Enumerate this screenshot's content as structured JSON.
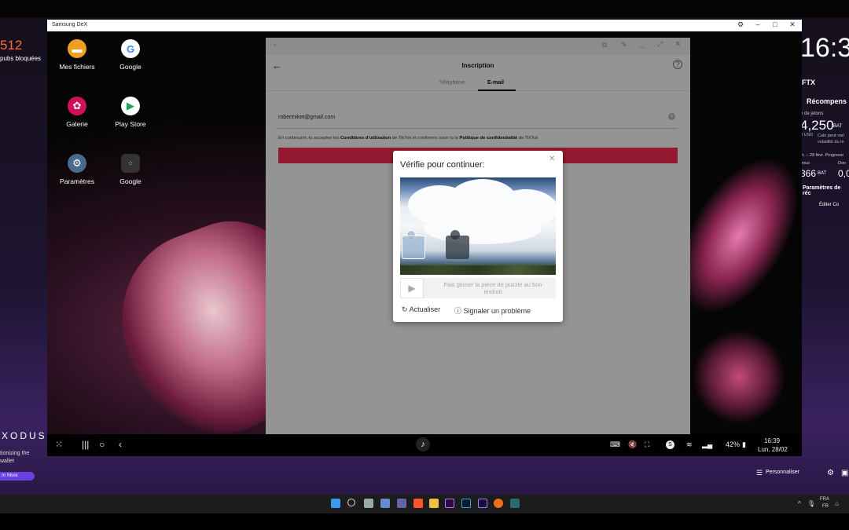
{
  "left_panel": {
    "count": "512",
    "blocked_label": "pubs bloquées",
    "exodus_brand": "XODUS",
    "exodus_line1": "tionizing the",
    "exodus_line2": "wallet",
    "learn_more": "rn More"
  },
  "right_panel": {
    "time": "16:3",
    "ftx": "FTX",
    "recompenses": "Récompens",
    "jetons_label": "e de jetons",
    "bat_amount": "4,250",
    "bat_unit": "BAT",
    "usd": "0 USD",
    "calc_note": "Calo peut vari volatilité du m",
    "progress_label": "vr. – 28 févr. Progressi",
    "bonus_label": "onus",
    "don_label": "Don",
    "bonus_value": "366",
    "bonus_unit": "BAT",
    "don_value": "0,0",
    "params": "Paramètres de réc",
    "editer": "Éditer Co",
    "personnaliser": "Personnaliser"
  },
  "dex": {
    "window_title": "Samsung DeX",
    "apps": [
      {
        "label": "Mes fichiers",
        "icon": "folder-icon",
        "color": "#f0a020"
      },
      {
        "label": "Google",
        "icon": "google-icon",
        "color": "#ffffff"
      },
      {
        "label": "Galerie",
        "icon": "gallery-icon",
        "color": "#d0105a"
      },
      {
        "label": "Play Store",
        "icon": "play-store-icon",
        "color": "#ffffff"
      },
      {
        "label": "Paramètres",
        "icon": "settings-icon",
        "color": "#4a6a8a"
      },
      {
        "label": "Google",
        "icon": "google-folder-icon",
        "color": "#333333"
      }
    ],
    "taskbar": {
      "battery": "42%",
      "time": "16:39",
      "date": "Lun. 28/02"
    }
  },
  "tiktok": {
    "title": "Inscription",
    "tabs": [
      "Téléphone",
      "E-mail"
    ],
    "active_tab": "E-mail",
    "email_value": "robertniket@gmail.com",
    "terms_prefix": "En continuant, tu acceptes les",
    "terms_link": "Conditions d'utilisation",
    "terms_mid": "de TikTok et confirmes avoir lu la",
    "privacy_link": "Politique de confidentialité",
    "terms_suffix": "de TikTok",
    "accent": "#fe2c55"
  },
  "captcha": {
    "title": "Vérifie pour continuer:",
    "slider_hint": "Fais glisser la pièce de puzzle au bon endroit",
    "refresh_label": "Actualiser",
    "report_label": "Signaler un problème"
  },
  "windows_taskbar": {
    "lang_top": "FRA",
    "lang_bottom": "FR"
  }
}
